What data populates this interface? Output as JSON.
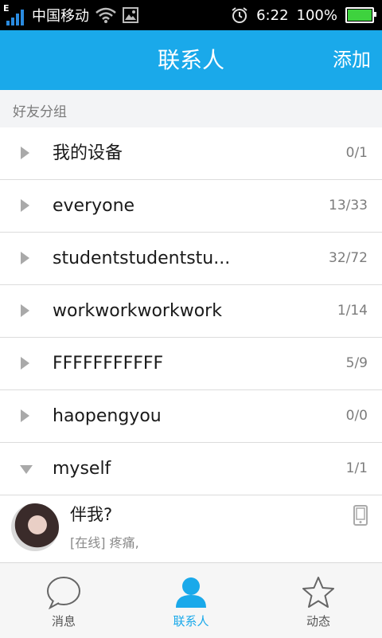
{
  "status_bar": {
    "network_type": "E",
    "carrier": "中国移动",
    "time": "6:22",
    "battery_percent": "100%",
    "battery_level": 1.0
  },
  "header": {
    "title": "联系人",
    "add_label": "添加",
    "color": "#1aa9ea"
  },
  "section_label": "好友分组",
  "groups": [
    {
      "name": "我的设备",
      "count": "0/1",
      "expanded": false
    },
    {
      "name": "everyone",
      "count": "13/33",
      "expanded": false
    },
    {
      "name": "studentstudentstu...",
      "count": "32/72",
      "expanded": false
    },
    {
      "name": "workworkworkwork",
      "count": "1/14",
      "expanded": false
    },
    {
      "name": "FFFFFFFFFFF",
      "count": "5/9",
      "expanded": false
    },
    {
      "name": "haopengyou",
      "count": "0/0",
      "expanded": false
    },
    {
      "name": "myself",
      "count": "1/1",
      "expanded": true
    }
  ],
  "contact": {
    "name": "伴我?",
    "status": "[在线] 疼痛,",
    "device_icon": "phone-icon"
  },
  "tabs": [
    {
      "label": "消息",
      "icon": "message-icon",
      "active": false
    },
    {
      "label": "联系人",
      "icon": "contacts-icon",
      "active": true
    },
    {
      "label": "动态",
      "icon": "star-icon",
      "active": false
    }
  ]
}
